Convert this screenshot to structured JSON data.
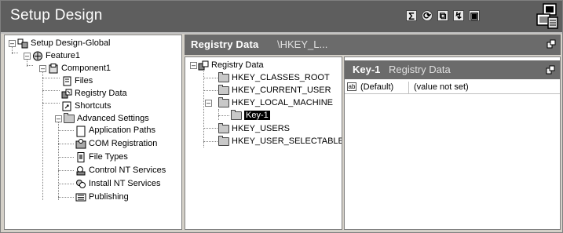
{
  "title": "Setup Design",
  "toolbar": {
    "icons": [
      "sigma-icon",
      "refresh-icon",
      "copy-icon",
      "wizard-icon",
      "settings-icon"
    ]
  },
  "left_tree": [
    {
      "label": "Setup Design-Global",
      "icon": "global-icon"
    },
    {
      "label": "Feature1",
      "icon": "feature-icon"
    },
    {
      "label": "Component1",
      "icon": "component-icon"
    },
    {
      "label": "Files",
      "icon": "files-icon"
    },
    {
      "label": "Registry Data",
      "icon": "registry-icon"
    },
    {
      "label": "Shortcuts",
      "icon": "shortcut-icon"
    },
    {
      "label": "Advanced Settings",
      "icon": "folder-icon"
    },
    {
      "label": "Application Paths",
      "icon": "doc-icon"
    },
    {
      "label": "COM Registration",
      "icon": "com-icon"
    },
    {
      "label": "File Types",
      "icon": "filetype-icon"
    },
    {
      "label": "Control NT Services",
      "icon": "service-icon"
    },
    {
      "label": "Install NT Services",
      "icon": "install-service-icon"
    },
    {
      "label": "Publishing",
      "icon": "publishing-icon"
    }
  ],
  "middle": {
    "header_title": "Registry Data",
    "header_path": "\\HKEY_L...",
    "tree": [
      {
        "label": "Registry Data"
      },
      {
        "label": "HKEY_CLASSES_ROOT"
      },
      {
        "label": "HKEY_CURRENT_USER"
      },
      {
        "label": "HKEY_LOCAL_MACHINE"
      },
      {
        "label": "Key-1"
      },
      {
        "label": "HKEY_USERS"
      },
      {
        "label": "HKEY_USER_SELECTABLE"
      }
    ]
  },
  "right": {
    "header_title": "Key-1",
    "header_sub": "Registry Data",
    "rows": [
      {
        "name": "(Default)",
        "value": "(value not set)",
        "icon_text": "ab"
      }
    ]
  }
}
